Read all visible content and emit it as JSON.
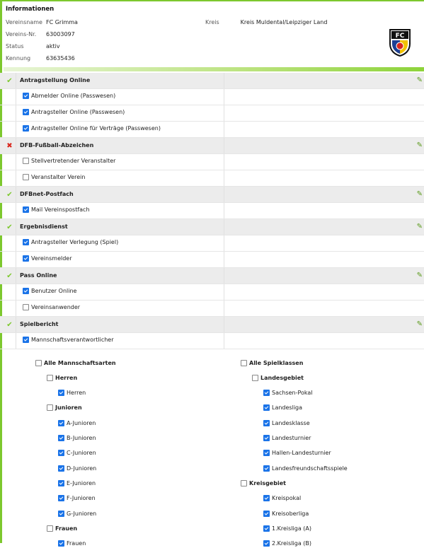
{
  "info": {
    "title": "Informationen",
    "vereinsname_label": "Vereinsname",
    "vereinsname": "FC Grimma",
    "vereinsnr_label": "Vereins-Nr.",
    "vereinsnr": "63003097",
    "status_label": "Status",
    "status": "aktiv",
    "kennung_label": "Kennung",
    "kennung": "63635436",
    "kreis_label": "Kreis",
    "kreis": "Kreis Muldental/Leipziger Land",
    "logo_text": "FC"
  },
  "sections": [
    {
      "title": "Antragstellung Online",
      "status": "ok",
      "items": [
        {
          "label": "Abmelder Online (Passwesen)",
          "checked": true
        },
        {
          "label": "Antragsteller Online (Passwesen)",
          "checked": true
        },
        {
          "label": "Antragsteller Online für Verträge (Passwesen)",
          "checked": true
        }
      ]
    },
    {
      "title": "DFB-Fußball-Abzeichen",
      "status": "no",
      "items": [
        {
          "label": "Stellvertretender Veranstalter",
          "checked": false
        },
        {
          "label": "Veranstalter Verein",
          "checked": false
        }
      ]
    },
    {
      "title": "DFBnet-Postfach",
      "status": "ok",
      "items": [
        {
          "label": "Mail Vereinspostfach",
          "checked": true
        }
      ]
    },
    {
      "title": "Ergebnisdienst",
      "status": "ok",
      "items": [
        {
          "label": "Antragsteller Verlegung (Spiel)",
          "checked": true
        },
        {
          "label": "Vereinsmelder",
          "checked": true
        }
      ]
    },
    {
      "title": "Pass Online",
      "status": "ok",
      "items": [
        {
          "label": "Benutzer Online",
          "checked": true
        },
        {
          "label": "Vereinsanwender",
          "checked": false
        }
      ]
    },
    {
      "title": "Spielbericht",
      "status": "ok",
      "items": [
        {
          "label": "Mannschaftsverantwortlicher",
          "checked": true
        }
      ]
    }
  ],
  "left_tree": [
    {
      "label": "Alle Mannschaftsarten",
      "checked": false,
      "level": 0,
      "bold": true
    },
    {
      "label": "Herren",
      "checked": false,
      "level": 1,
      "bold": true
    },
    {
      "label": "Herren",
      "checked": true,
      "level": 2,
      "bold": false
    },
    {
      "label": "Junioren",
      "checked": false,
      "level": 1,
      "bold": true
    },
    {
      "label": "A-Junioren",
      "checked": true,
      "level": 2,
      "bold": false
    },
    {
      "label": "B-Junioren",
      "checked": true,
      "level": 2,
      "bold": false
    },
    {
      "label": "C-Junioren",
      "checked": true,
      "level": 2,
      "bold": false
    },
    {
      "label": "D-Junioren",
      "checked": true,
      "level": 2,
      "bold": false
    },
    {
      "label": "E-Junioren",
      "checked": true,
      "level": 2,
      "bold": false
    },
    {
      "label": "F-Junioren",
      "checked": true,
      "level": 2,
      "bold": false
    },
    {
      "label": "G-Junioren",
      "checked": true,
      "level": 2,
      "bold": false
    },
    {
      "label": "Frauen",
      "checked": false,
      "level": 1,
      "bold": true
    },
    {
      "label": "Frauen",
      "checked": true,
      "level": 2,
      "bold": false
    }
  ],
  "right_tree": [
    {
      "label": "Alle Spielklassen",
      "checked": false,
      "level": 0,
      "bold": true
    },
    {
      "label": "Landesgebiet",
      "checked": false,
      "level": 1,
      "bold": true
    },
    {
      "label": "Sachsen-Pokal",
      "checked": true,
      "level": 2,
      "bold": false
    },
    {
      "label": "Landesliga",
      "checked": true,
      "level": 2,
      "bold": false
    },
    {
      "label": "Landesklasse",
      "checked": true,
      "level": 2,
      "bold": false
    },
    {
      "label": "Landesturnier",
      "checked": true,
      "level": 2,
      "bold": false
    },
    {
      "label": "Hallen-Landesturnier",
      "checked": true,
      "level": 2,
      "bold": false
    },
    {
      "label": "Landesfreundschaftsspiele",
      "checked": true,
      "level": 2,
      "bold": false
    },
    {
      "label": "Kreisgebiet",
      "checked": false,
      "level": 0,
      "bold": true
    },
    {
      "label": "Kreispokal",
      "checked": true,
      "level": 2,
      "bold": false
    },
    {
      "label": "Kreisoberliga",
      "checked": true,
      "level": 2,
      "bold": false
    },
    {
      "label": "1.Kreisliga (A)",
      "checked": true,
      "level": 2,
      "bold": false
    },
    {
      "label": "2.Kreisliga (B)",
      "checked": true,
      "level": 2,
      "bold": false
    }
  ]
}
